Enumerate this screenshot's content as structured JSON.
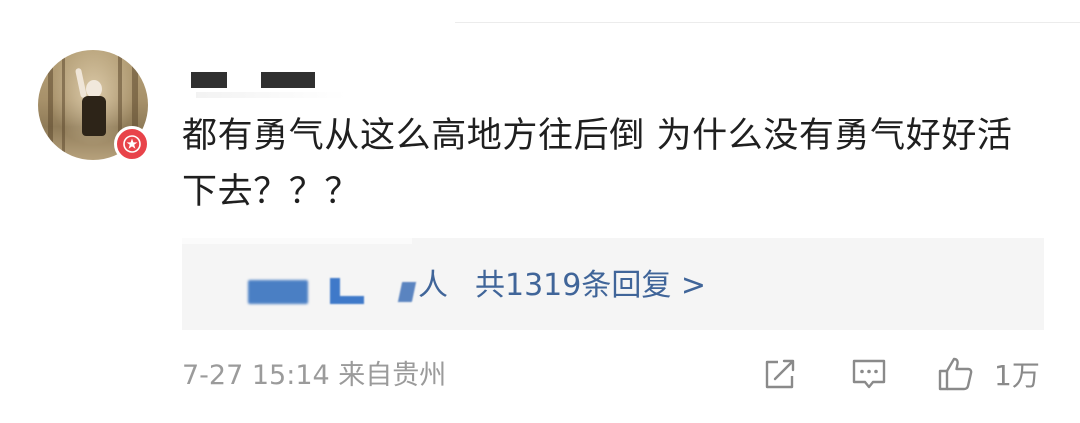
{
  "comment": {
    "text": "都有勇气从这么高地方往后倒 为什么没有勇气好好活下去？？？"
  },
  "replies": {
    "person_suffix": "人",
    "count_label": "共1319条回复 >"
  },
  "footer": {
    "time_location": "7-27 15:14 来自贵州",
    "like_count": "1万"
  },
  "icons": [
    "verified-badge-icon",
    "share-icon",
    "comment-icon",
    "like-icon"
  ],
  "colors": {
    "link": "#406599",
    "badge": "#e8434a"
  }
}
